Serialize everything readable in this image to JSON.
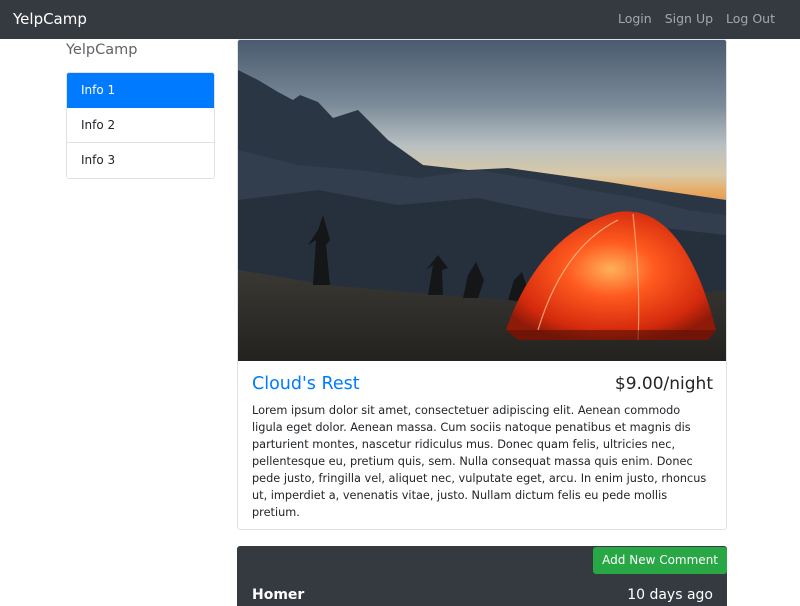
{
  "navbar": {
    "brand": "YelpCamp",
    "links": [
      "Login",
      "Sign Up",
      "Log Out"
    ]
  },
  "sidebar": {
    "title": "YelpCamp",
    "items": [
      {
        "label": "Info 1",
        "active": true
      },
      {
        "label": "Info 2",
        "active": false
      },
      {
        "label": "Info 3",
        "active": false
      }
    ]
  },
  "campground": {
    "name": "Cloud's Rest",
    "price": "$9.00/night",
    "description": "Lorem ipsum dolor sit amet, consectetuer adipiscing elit. Aenean commodo ligula eget dolor. Aenean massa. Cum sociis natoque penatibus et magnis dis parturient montes, nascetur ridiculus mus. Donec quam felis, ultricies nec, pellentesque eu, pretium quis, sem. Nulla consequat massa quis enim. Donec pede justo, fringilla vel, aliquet nec, vulputate eget, arcu. In enim justo, rhoncus ut, imperdiet a, venenatis vitae, justo. Nullam dictum felis eu pede mollis pretium."
  },
  "comments": {
    "add_label": "Add New Comment",
    "items": [
      {
        "author": "Homer",
        "time": "10 days ago"
      }
    ]
  },
  "colors": {
    "navbar": "#343a40",
    "primary": "#007bff",
    "success": "#28a745"
  }
}
